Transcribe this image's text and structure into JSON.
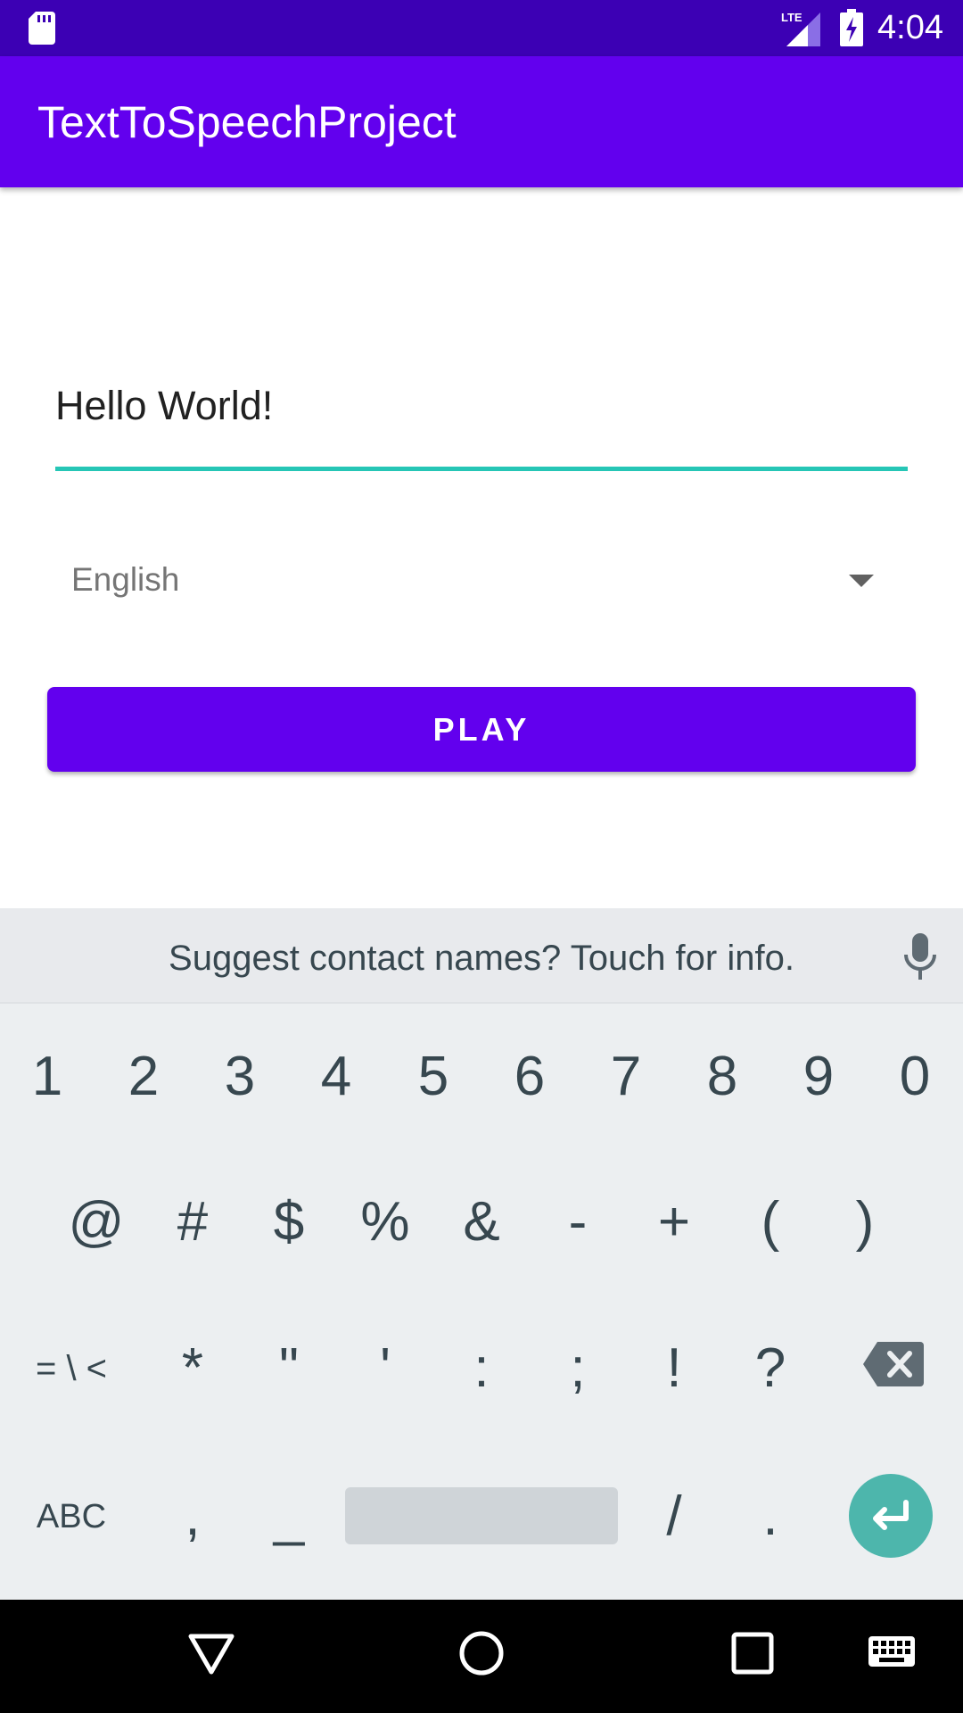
{
  "status_bar": {
    "time": "4:04",
    "network": "LTE"
  },
  "app_bar": {
    "title": "TextToSpeechProject"
  },
  "text_input": {
    "value": "Hello World!"
  },
  "language_spinner": {
    "selected": "English"
  },
  "play_button": {
    "label": "PLAY"
  },
  "keyboard": {
    "suggestion": "Suggest contact names? Touch for info.",
    "row1": [
      "1",
      "2",
      "3",
      "4",
      "5",
      "6",
      "7",
      "8",
      "9",
      "0"
    ],
    "row2": [
      "@",
      "#",
      "$",
      "%",
      "&",
      "-",
      "+",
      "(",
      ")"
    ],
    "row3": [
      "= \\ <",
      "*",
      "\"",
      "'",
      ":",
      ";",
      "!",
      "?"
    ],
    "row4": {
      "abc": "ABC",
      "comma": ",",
      "underscore": "_",
      "slash": "/",
      "period": "."
    }
  },
  "colors": {
    "primary": "#6200ee",
    "primary_dark": "#3c00b4",
    "accent": "#26c6b6",
    "enter_key": "#4db6ac"
  },
  "icons": [
    "sd-card-icon",
    "signal-icon",
    "battery-charging-icon",
    "mic-icon",
    "backspace-icon",
    "enter-icon",
    "back-icon",
    "home-icon",
    "recents-icon",
    "keyboard-icon"
  ]
}
